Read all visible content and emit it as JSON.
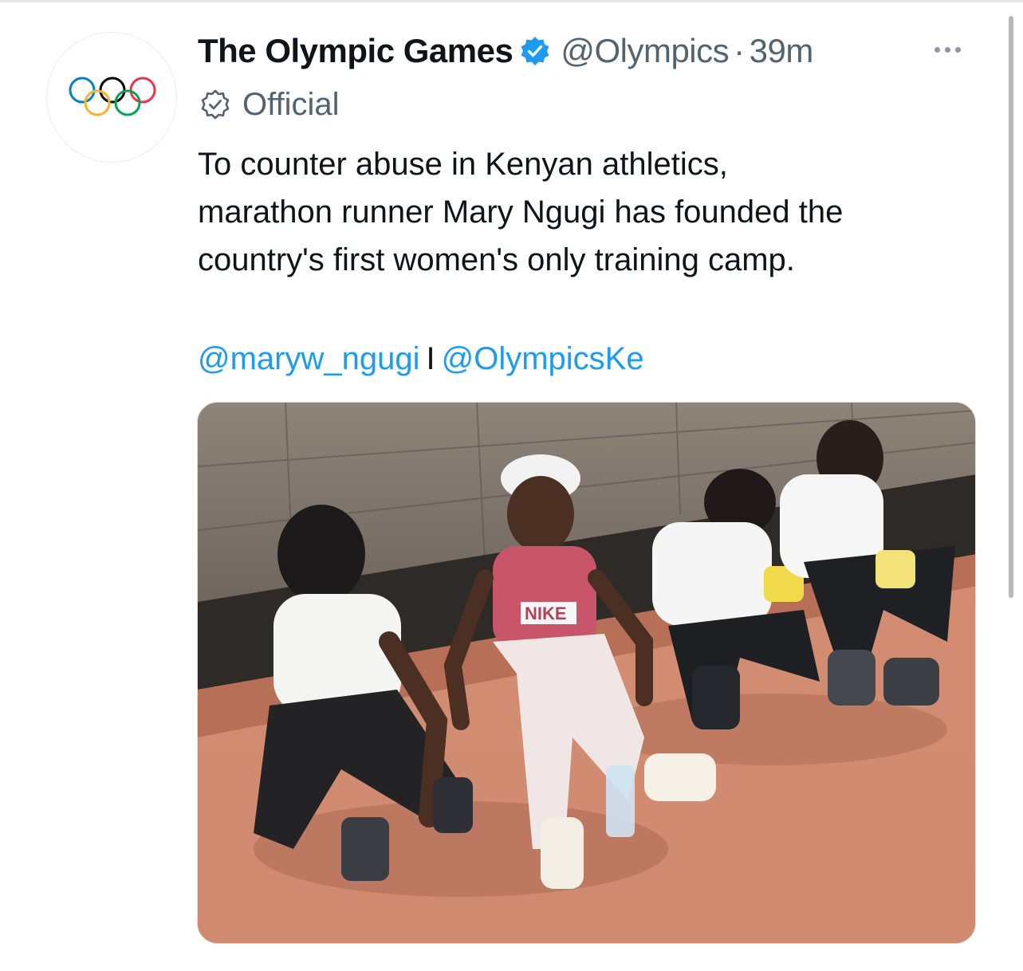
{
  "tweet": {
    "display_name": "The Olympic Games",
    "handle": "@Olympics",
    "separator": "·",
    "timestamp": "39m",
    "label": "Official",
    "text_lines": [
      "To counter abuse in Kenyan athletics,",
      "marathon runner Mary Ngugi has founded the",
      "country's first women's only training camp."
    ],
    "mentions": [
      "@maryw_ngugi",
      "@OlympicsKe"
    ],
    "mention_separator": "I",
    "image": {
      "shirt_print": "NIKE"
    }
  },
  "colors": {
    "link": "#1d9bf0",
    "verified_badge": "#1d9bf0",
    "secondary_text": "#536471",
    "olympic_rings": [
      "#0081c8",
      "#fcb131",
      "#000000",
      "#00a651",
      "#ee334e"
    ]
  },
  "icons": {
    "avatar": "olympic-rings-icon",
    "verified": "verified-badge-icon",
    "official": "official-label-icon",
    "more": "more-options-icon"
  }
}
